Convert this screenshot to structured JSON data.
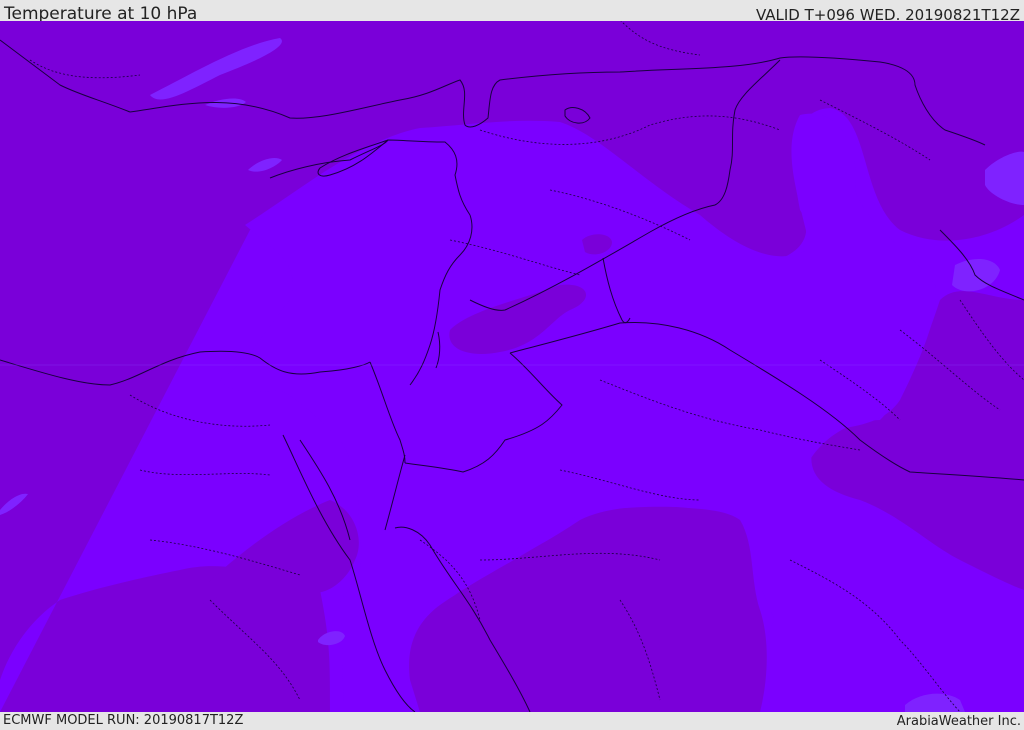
{
  "header": {
    "title": "Temperature at 10 hPa",
    "valid": "VALID T+096 WED. 20190821T12Z"
  },
  "footer": {
    "model_run": "ECMWF MODEL RUN: 20190817T12Z",
    "credit": "ArabiaWeather Inc."
  },
  "colors": {
    "colder_band": "#7a00d9",
    "warmer_band": "#7b00ff",
    "bright_patch": "#7f22ff",
    "borders": "#1a0040",
    "bar_background": "#e6e6e6"
  }
}
